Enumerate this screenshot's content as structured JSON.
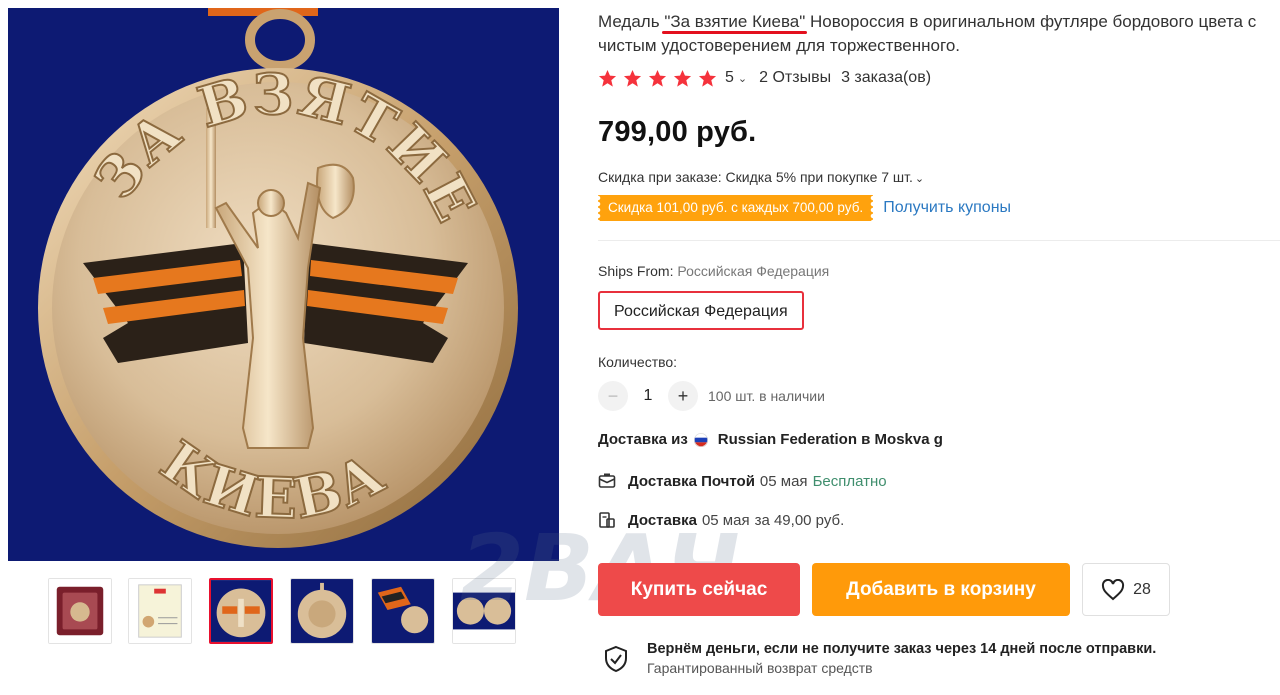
{
  "gallery": {
    "thumbnails": [
      {
        "name": "medal-case-thumb"
      },
      {
        "name": "certificate-thumb"
      },
      {
        "name": "medal-front-thumb",
        "active": true
      },
      {
        "name": "medal-back-thumb"
      },
      {
        "name": "medal-ribbon-thumb"
      },
      {
        "name": "medal-both-sides-thumb"
      }
    ]
  },
  "watermark": {
    "text": "2ВАЧ"
  },
  "product": {
    "title_before": "Медаль ",
    "title_highlight": "\"За взятие Киева\"",
    "title_after": " Новороссия в оригинальном футляре бордового цвета с чистым удостоверением для торжественного.",
    "rating": {
      "stars": 5,
      "score": "5",
      "reviews": "2 Отзывы",
      "orders": "3 заказа(ов)"
    },
    "price": "799,00 руб.",
    "discount": {
      "label": "Скидка при заказе: ",
      "value": "Скидка 5% при покупке 7 шт.",
      "coupon": "Скидка 101,00 руб. с каждых 700,00 руб.",
      "coupon_link": "Получить купоны"
    },
    "ships_from": {
      "label": "Ships From: ",
      "value": "Российская Федерация",
      "option": "Российская Федерация"
    },
    "quantity": {
      "label": "Количество:",
      "minus": "−",
      "value": "1",
      "plus": "+",
      "stock": "100 шт. в наличии"
    },
    "delivery": {
      "from_prefix": "Доставка из",
      "from_text": "Russian Federation в Moskva g",
      "options": [
        {
          "method": "Доставка Почтой",
          "date": "05 мая",
          "price": "Бесплатно"
        },
        {
          "method": "Доставка",
          "date": "05 мая",
          "price": "за 49,00 руб."
        }
      ]
    },
    "actions": {
      "buy": "Купить сейчас",
      "cart": "Добавить в корзину",
      "wishlist_count": "28"
    },
    "guarantee": {
      "title": "Вернём деньги, если не получите заказ через 14 дней после отправки.",
      "subtitle": "Гарантированный возврат средств"
    }
  },
  "colors": {
    "primary_red": "#ee4a4a",
    "orange": "#ff9a0a",
    "coupon_orange": "#ffa20d",
    "link_blue": "#2b79c2",
    "free_green": "#3f8e6d",
    "star_red": "#f5323c",
    "image_background": "#0d1a73"
  }
}
